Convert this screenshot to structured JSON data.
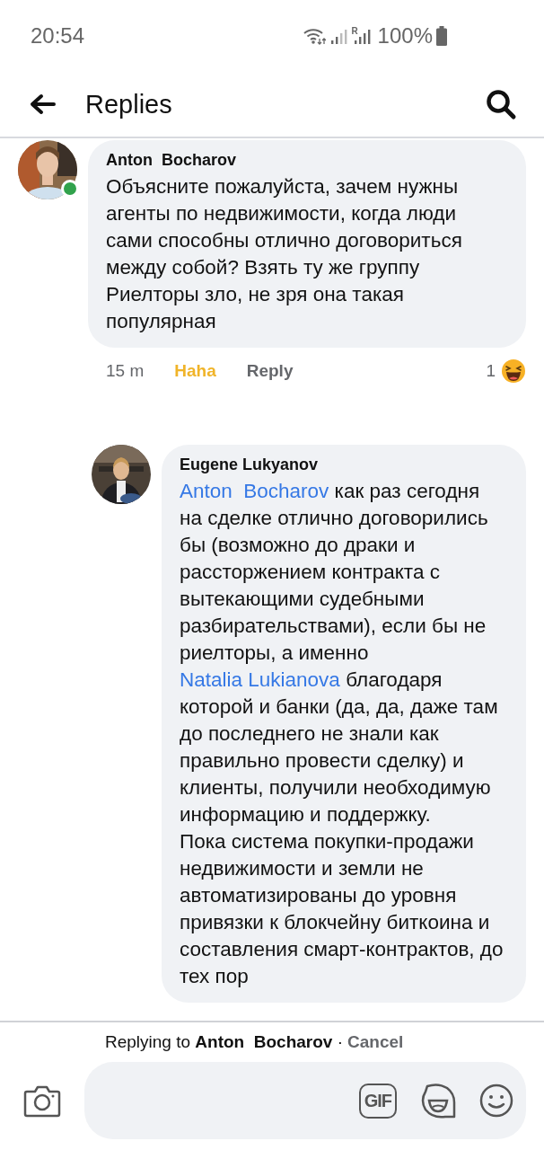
{
  "status_bar": {
    "time": "20:54",
    "roaming": "R",
    "battery": "100%"
  },
  "header": {
    "title": "Replies"
  },
  "comments": [
    {
      "author": "Anton  Bocharov",
      "online": true,
      "indent": false,
      "paragraphs": [
        [
          {
            "kind": "text",
            "text": "Объясните пожалуйста, зачем нужны агенты по недвижимости, когда люди сами способны отлично договориться между собой? Взять ту же группу Риелторы зло, не зря она такая популярная"
          }
        ]
      ],
      "time": "15 m",
      "reaction_label": "Haha",
      "reply_label": "Reply",
      "reaction_count": "1"
    },
    {
      "author": "Eugene Lukyanov",
      "online": false,
      "indent": true,
      "paragraphs": [
        [
          {
            "kind": "mention",
            "text": "Anton  Bocharov"
          },
          {
            "kind": "text",
            "text": " как раз сегодня на сделке отлично договорились бы (возможно до драки и расcторжением контракта с вытекающими судебными разбирательствами), если бы не риелторы, а именно "
          },
          {
            "kind": "mention",
            "text": "Natalia Lukianova"
          },
          {
            "kind": "text",
            "text": " благодаря которой и банки (да, да, даже там до последнего не знали как правильно провести сделку) и клиенты, получили необходимую информацию и поддержку."
          }
        ],
        [
          {
            "kind": "text",
            "text": "Пока система покупки-продажи недвижимости и земли не автоматизированы до уровня привязки к блокчейну биткоина и составления смарт-контрактов, до тех пор"
          }
        ]
      ]
    }
  ],
  "reply_bar": {
    "notice": "Replying to **Anton  Bocharov** ·",
    "cancel": "Cancel",
    "gif": "GIF"
  }
}
